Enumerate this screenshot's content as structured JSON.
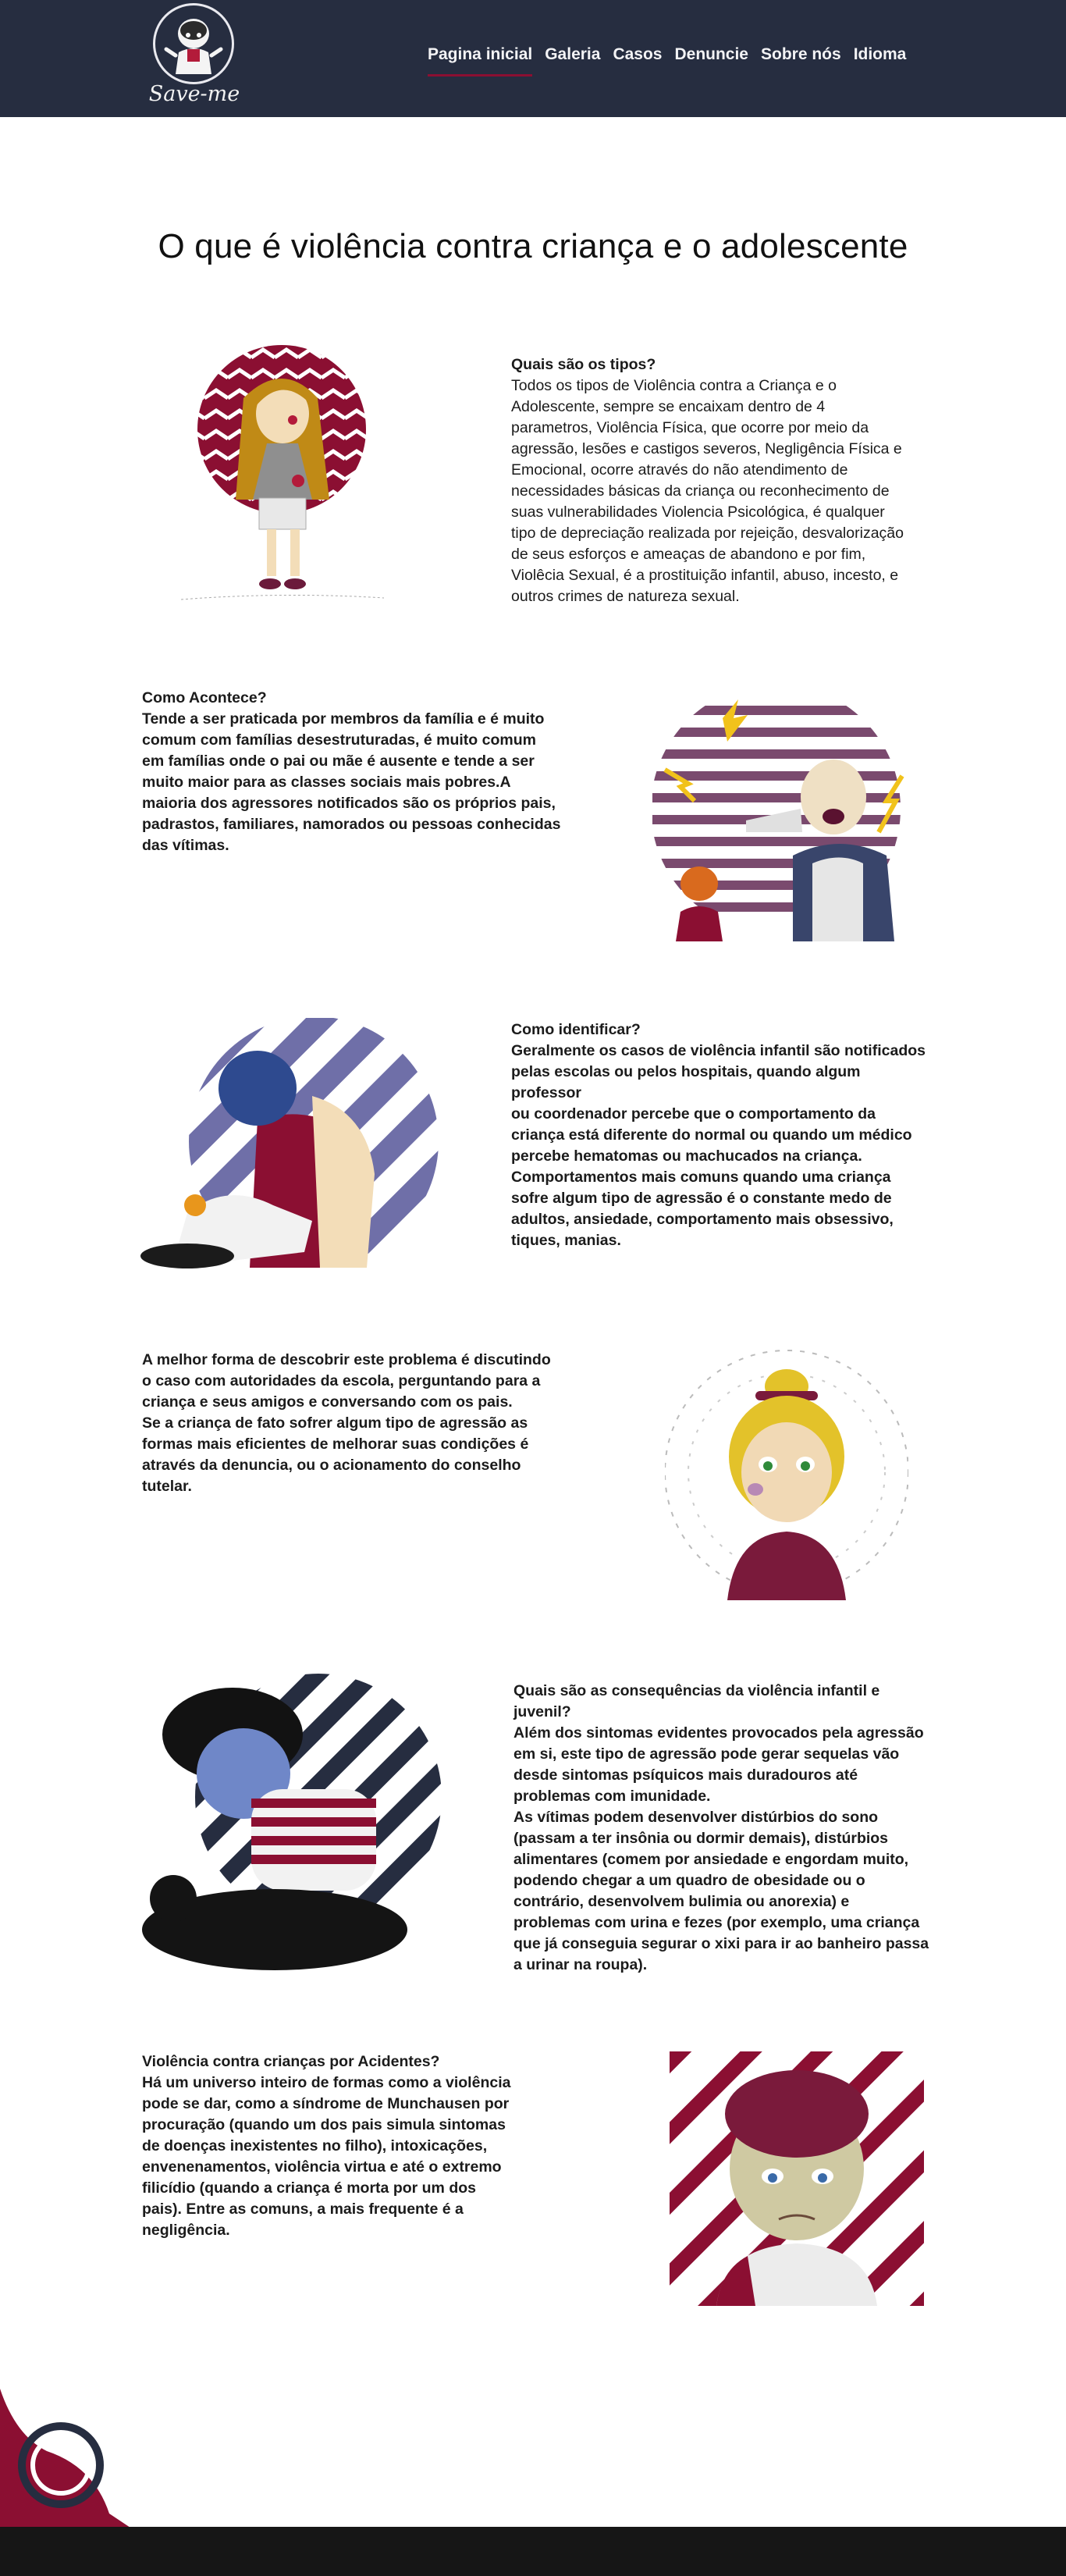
{
  "brand": {
    "name": "Save-me",
    "primary": "#262d40",
    "accent": "#8b0f32"
  },
  "nav": {
    "items": [
      {
        "label": "Pagina inicial",
        "active": true
      },
      {
        "label": "Galeria"
      },
      {
        "label": "Casos"
      },
      {
        "label": "Denuncie"
      },
      {
        "label": "Sobre nós"
      },
      {
        "label": "Idioma"
      }
    ]
  },
  "page_title": "O que é violência contra criança e o adolescente",
  "sections": [
    {
      "heading": "Quais são os tipos?",
      "body": "Todos os tipos de Violência contra a Criança e o\nAdolescente, sempre se encaixam dentro de 4\nparametros, Violência Física, que ocorre por meio da\nagressão, lesões e castigos severos, Negligência Física e\nEmocional, ocorre através do não atendimento de\nnecessidades básicas da criança ou reconhecimento de\nsuas vulnerabilidades Violencia Psicológica, é qualquer\ntipo de depreciação realizada por rejeição, desvalorização\nde seus esforços e ameaças de abandono e por fim,\nViolêcia Sexual, é a prostituição infantil, abuso, incesto, e\noutros crimes de natureza sexual."
    },
    {
      "heading": "Como Acontece?",
      "body": "Tende a ser praticada por membros da família e é muito\ncomum com famílias desestruturadas, é muito comum\nem famílias onde o pai ou mãe é ausente e tende a ser\nmuito maior para as classes sociais mais pobres.A\nmaioria dos agressores notificados são os próprios pais,\npadrastos, familiares, namorados ou pessoas conhecidas\ndas vítimas."
    },
    {
      "heading": "Como identificar?",
      "body": "Geralmente os casos de violência infantil são notificados\npelas escolas ou pelos hospitais, quando algum professor\nou coordenador percebe que o comportamento da\ncriança está diferente do normal ou quando um médico\npercebe hematomas ou machucados na criança.\nComportamentos mais comuns quando uma criança\nsofre algum tipo de agressão é o constante medo de\nadultos, ansiedade, comportamento mais obsessivo,\ntiques, manias."
    },
    {
      "heading": "",
      "body": "A melhor forma de descobrir este problema é discutindo\no caso com autoridades da escola, perguntando para a\ncriança e seus amigos e conversando com os pais.\nSe a criança de fato sofrer algum tipo de agressão as\nformas mais eficientes de melhorar suas condições é\natravés da denuncia, ou o acionamento do conselho\ntutelar."
    },
    {
      "heading": "Quais são as consequências da violência infantil e\njuvenil?",
      "body": "Além dos sintomas evidentes provocados pela agressão\nem si, este tipo de agressão pode gerar sequelas vão\ndesde sintomas psíquicos mais duradouros até\nproblemas com imunidade.\nAs vítimas podem desenvolver distúrbios do sono\n(passam a ter insônia ou dormir demais), distúrbios\nalimentares (comem por ansiedade e engordam muito,\npodendo chegar a um quadro de obesidade ou o\ncontrário, desenvolvem bulimia ou anorexia) e\nproblemas com urina e fezes (por exemplo, uma criança\nque já conseguia segurar o xixi para ir ao banheiro passa\na urinar na roupa)."
    },
    {
      "heading": "Violência contra crianças por Acidentes?",
      "body": "Há um universo inteiro de formas como a violência\npode se dar, como a síndrome de Munchausen por\nprocuração (quando um dos pais simula sintomas\nde doenças inexistentes no filho), intoxicações,\nenvenenamentos, violência virtua e até o extremo\nfilicídio (quando a criança é morta por um dos\npais). Entre as comuns, a mais frequente é a\nnegligência."
    }
  ]
}
